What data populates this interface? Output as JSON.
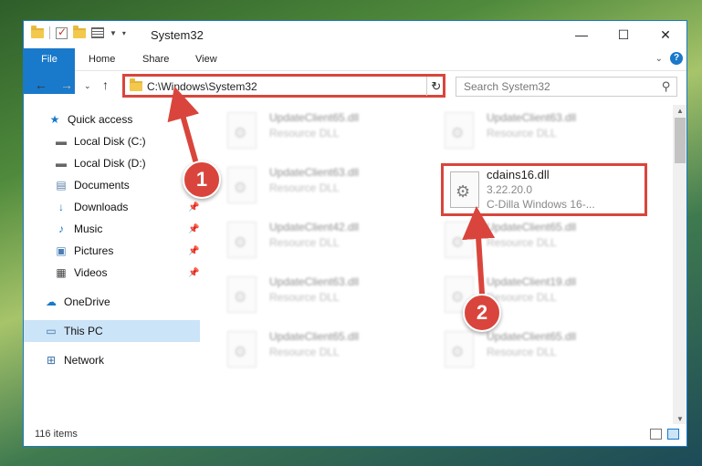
{
  "window": {
    "title": "System32"
  },
  "ribbon": {
    "file": "File",
    "home": "Home",
    "share": "Share",
    "view": "View",
    "help": "?"
  },
  "address": {
    "path": "C:\\Windows\\System32",
    "search_placeholder": "Search System32"
  },
  "sidebar": {
    "items": [
      {
        "label": "Quick access",
        "icon": "star-icon",
        "pinned": false
      },
      {
        "label": "Local Disk (C:)",
        "icon": "drive-icon",
        "pinned": false
      },
      {
        "label": "Local Disk (D:)",
        "icon": "drive-icon",
        "pinned": false
      },
      {
        "label": "Documents",
        "icon": "documents-icon",
        "pinned": false
      },
      {
        "label": "Downloads",
        "icon": "downloads-icon",
        "pinned": true
      },
      {
        "label": "Music",
        "icon": "music-icon",
        "pinned": true
      },
      {
        "label": "Pictures",
        "icon": "pictures-icon",
        "pinned": true
      },
      {
        "label": "Videos",
        "icon": "videos-icon",
        "pinned": true
      },
      {
        "label": "OneDrive",
        "icon": "onedrive-icon",
        "pinned": false
      },
      {
        "label": "This PC",
        "icon": "pc-icon",
        "pinned": false,
        "selected": true
      },
      {
        "label": "Network",
        "icon": "network-icon",
        "pinned": false
      }
    ]
  },
  "files": {
    "left": [
      {
        "name": "UpdateClient65.dll",
        "desc": "Resource DLL"
      },
      {
        "name": "UpdateClient63.dll",
        "desc": "Resource DLL"
      },
      {
        "name": "UpdateClient42.dll",
        "desc": "Resource DLL"
      },
      {
        "name": "UpdateClient63.dll",
        "desc": "Resource DLL"
      },
      {
        "name": "UpdateClient65.dll",
        "desc": "Resource DLL"
      }
    ],
    "right": [
      {
        "name": "UpdateClient63.dll",
        "desc": "Resource DLL"
      },
      {
        "name": "UpdateClient65.dll",
        "desc": "Resource DLL"
      },
      {
        "name": "UpdateClient19.dll",
        "desc": "Resource DLL"
      },
      {
        "name": "UpdateClient65.dll",
        "desc": "Resource DLL"
      }
    ],
    "highlighted": {
      "name": "cdains16.dll",
      "version": "3.22.20.0",
      "desc": "C-Dilla Windows 16-..."
    }
  },
  "status": {
    "items": "116 items"
  },
  "markers": {
    "one": "1",
    "two": "2"
  },
  "colors": {
    "accent": "#1979ca",
    "highlight": "#d9453c",
    "selected": "#cce4f7"
  }
}
